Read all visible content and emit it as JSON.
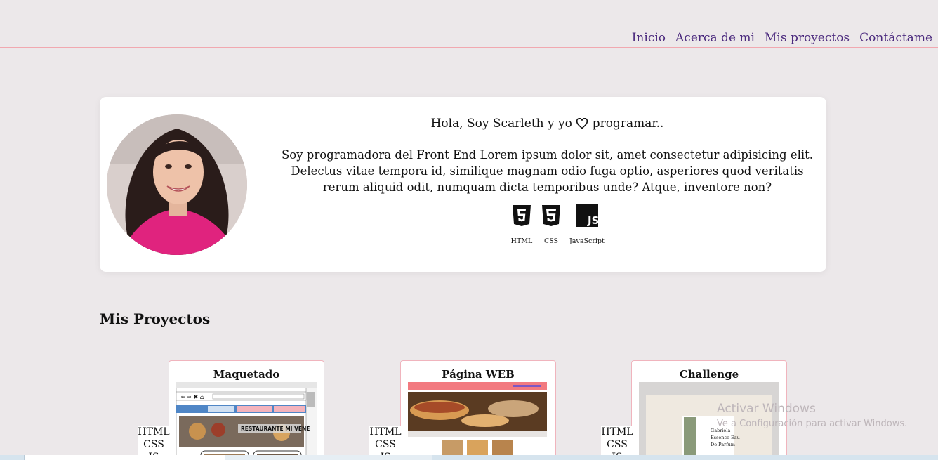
{
  "nav": {
    "items": [
      "Inicio",
      "Acerca de mi",
      "Mis proyectos",
      "Contáctame"
    ]
  },
  "hero": {
    "greeting_before": "Hola, Soy Scarleth y yo",
    "greeting_after": "programar..",
    "intro": "Soy programadora del Front End Lorem ipsum dolor sit, amet consectetur adipisicing elit. Delectus vitae tempora id, similique magnam odio fuga optio, asperiores quod veritatis rerum aliquid odit, numquam dicta temporibus unde? Atque, inventore non?",
    "tech": [
      {
        "label": "HTML",
        "icon": "html5-icon"
      },
      {
        "label": "CSS",
        "icon": "css3-icon"
      },
      {
        "label": "JavaScript",
        "icon": "javascript-icon"
      }
    ]
  },
  "projects": {
    "title": "Mis Proyectos",
    "cards": [
      {
        "title": "Maquetado",
        "tags": [
          "HTML",
          "CSS",
          "JS"
        ],
        "thumb_text": "RESTAURANTE MI VENE"
      },
      {
        "title": "Página WEB",
        "tags": [
          "HTML",
          "CSS",
          "JS"
        ]
      },
      {
        "title": "Challenge",
        "tags": [
          "HTML",
          "CSS",
          "JS"
        ],
        "thumb_text": "Gabriela Essence Eau De Parfum"
      }
    ]
  },
  "watermark": {
    "line1": "Activar Windows",
    "line2": "Ve a Configuración para activar Windows."
  },
  "colors": {
    "background": "#ece8ea",
    "nav_link": "#4b2a7e",
    "divider": "#f1a8b0",
    "card_border": "#f0b4bd"
  }
}
